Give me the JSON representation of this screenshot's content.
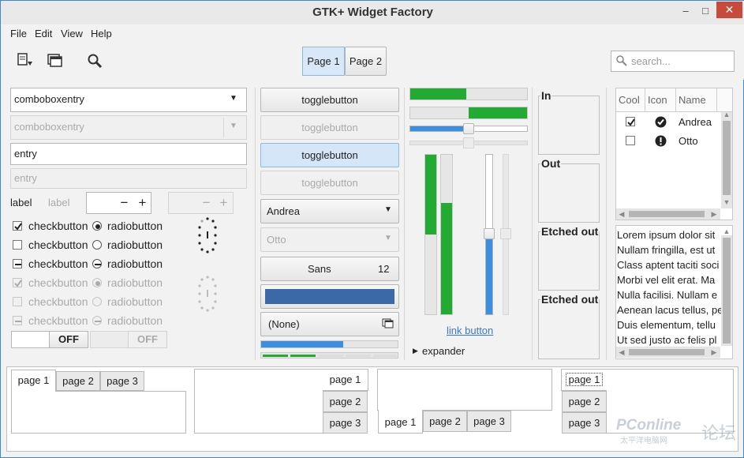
{
  "window": {
    "title": "GTK+ Widget Factory",
    "minimize": "–",
    "maximize": "□",
    "close": "✕"
  },
  "menubar": {
    "items": [
      "File",
      "Edit",
      "View",
      "Help"
    ]
  },
  "toolbar": {
    "icons": [
      "document-open-icon",
      "copy-windows-icon",
      "magnifier-icon"
    ],
    "stack_buttons": [
      "Page 1",
      "Page 2"
    ],
    "search_placeholder": "search..."
  },
  "col1": {
    "combo1": "comboboxentry",
    "combo2": "comboboxentry",
    "entry1": "entry",
    "entry2": "entry",
    "label1": "label",
    "label2": "label",
    "spin_minus": "−",
    "spin_plus": "+",
    "checks": [
      "checkbutton",
      "checkbutton",
      "checkbutton",
      "checkbutton",
      "checkbutton",
      "checkbutton"
    ],
    "radios": [
      "radiobutton",
      "radiobutton",
      "radiobutton",
      "radiobutton",
      "radiobutton",
      "radiobutton"
    ],
    "switch1": "OFF",
    "switch2": "OFF"
  },
  "col2": {
    "toggles": [
      "togglebutton",
      "togglebutton",
      "togglebutton",
      "togglebutton"
    ],
    "combo_andrea": "Andrea",
    "combo_otto": "Otto",
    "font_name": "Sans",
    "font_size": "12",
    "file_none": "(None)",
    "progress": 0.6
  },
  "col3": {
    "hbar1": 0.48,
    "hbar2": 0.5,
    "hscale": 0.5,
    "vbar_fill1": 0.5,
    "vbar_fill2": 0.7,
    "link": "link button",
    "expander": "expander"
  },
  "col4": {
    "frames": [
      "In",
      "Out",
      "Etched out",
      "Etched out"
    ]
  },
  "col5": {
    "headers": [
      "Cool",
      "Icon",
      "Name"
    ],
    "rows": [
      {
        "checked": true,
        "icon": "check-circle-icon",
        "name": "Andrea"
      },
      {
        "checked": false,
        "icon": "exclamation-circle-icon",
        "name": "Otto"
      }
    ],
    "lorem": [
      "Lorem ipsum dolor sit",
      "Nullam fringilla, est ut",
      "Class aptent taciti soci",
      "Morbi vel elit erat. Ma",
      "Nulla facilisi. Nullam e",
      "Aenean lacus tellus, pe",
      "Duis elementum, tellu",
      "Ut sed justo ac felis pl"
    ]
  },
  "notebooks": {
    "nb1": [
      "page 1",
      "page 2",
      "page 3"
    ],
    "nb2": [
      "page 1",
      "page 2",
      "page 3"
    ],
    "nb3": [
      "page 1",
      "page 2",
      "page 3"
    ],
    "nb4": [
      "page 1",
      "page 2",
      "page 3"
    ]
  },
  "watermark": {
    "brand": "PConline",
    "sub": "太平洋电脑网",
    "side": "论坛"
  }
}
